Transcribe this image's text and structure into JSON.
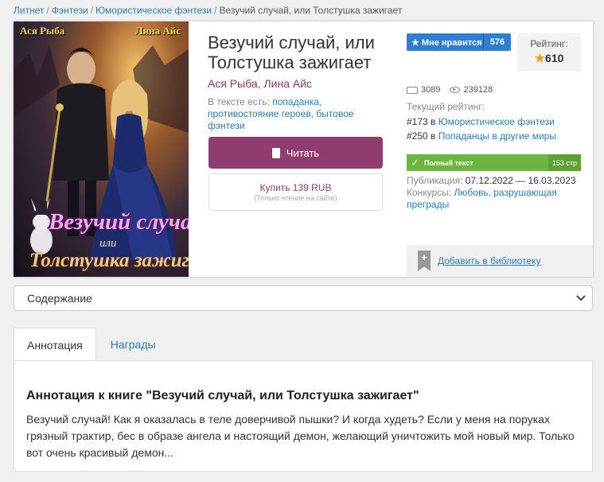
{
  "breadcrumb": {
    "items": [
      "Литнет",
      "Фэнтези",
      "Юмористическое фэнтези"
    ],
    "current": "Везучий случай, или Толстушка зажигает"
  },
  "cover": {
    "author_left": "Ася Рыба",
    "author_right": "Лина Айс",
    "title_line1": "Везучий случай,",
    "title_line2": "или",
    "title_line3": "Толстушка зажигает"
  },
  "book": {
    "title": "Везучий случай, или Толстушка зажигает",
    "authors": "Ася Рыба, Лина Айс",
    "tags_label": "В тексте есть:",
    "tags": "попаданка, противостояние героев, бытовое фэнтези"
  },
  "actions": {
    "read_label": "Читать",
    "buy_label": "Купить 139 RUB",
    "buy_note": "(Только чтение на сайте)"
  },
  "like": {
    "label": "★ Мне нравится",
    "count": "576"
  },
  "rating": {
    "label": "Рейтинг:",
    "star": "★",
    "value": "610"
  },
  "stats": {
    "chars": "3089",
    "views": "239128"
  },
  "current_rating": {
    "label": "Текущий рейтинг:",
    "ranks": [
      {
        "pos": "#173 в",
        "category": "Юмористическое фэнтези"
      },
      {
        "pos": "#250 в",
        "category": "Попаданцы в другие миры"
      }
    ]
  },
  "status": {
    "check": "✓",
    "text": "Полный текст",
    "pages": "153 стр"
  },
  "publication": {
    "label": "Публикация:",
    "dates": "07.12.2022 — 16.03.2023"
  },
  "contests": {
    "label": "Конкурсы:",
    "value": "Любовь, разрушающая преграды"
  },
  "library": {
    "plus": "+",
    "label": "Добавить в библиотеку"
  },
  "contents": {
    "selected": "Содержание",
    "chevron": "⌄"
  },
  "tabs": [
    {
      "label": "Аннотация",
      "active": true
    },
    {
      "label": "Награды",
      "active": false
    }
  ],
  "annotation": {
    "heading": "Аннотация к книге \"Везучий случай, или Толстушка зажигает\"",
    "text": "Везучий случай! Как я оказалась в теле доверчивой пышки? И когда худеть? Если у меня на поруках грязный трактир, бес в образе ангела и настоящий демон, желающий уничтожить мой новый мир. Только вот очень красивый демон..."
  },
  "colors": {
    "accent_purple": "#8e3d6e",
    "link_blue": "#2a7bb8",
    "like_blue": "#2f7ed1",
    "status_green": "#6cb53e",
    "star_orange": "#f0a21e"
  }
}
